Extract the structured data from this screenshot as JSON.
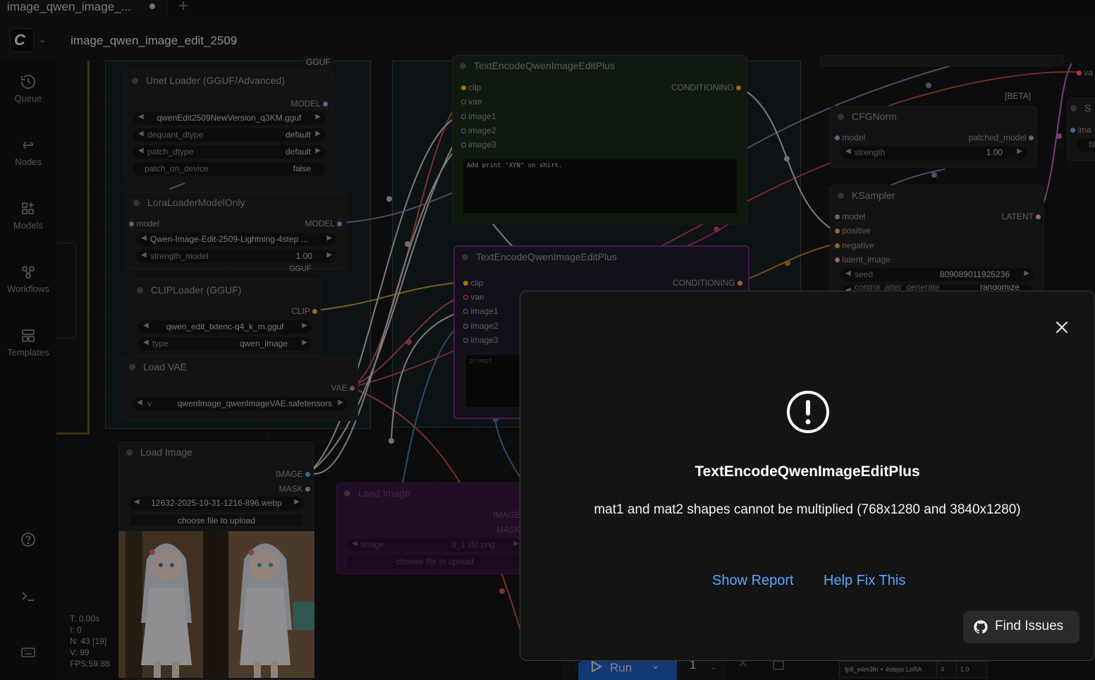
{
  "tab": {
    "title": "image_qwen_image_...",
    "add_label": "+"
  },
  "menubar": {
    "workflow_name": "image_qwen_image_edit_2509",
    "logo_glyph": "C"
  },
  "sidebar": {
    "items": [
      {
        "label": "Queue",
        "icon": "history-icon"
      },
      {
        "label": "Nodes",
        "icon": "nodes-icon"
      },
      {
        "label": "Models",
        "icon": "models-icon"
      },
      {
        "label": "Workflows",
        "icon": "workflows-icon"
      },
      {
        "label": "Templates",
        "icon": "templates-icon"
      }
    ]
  },
  "stats": {
    "t": "T: 0.00s",
    "i": "I: 0",
    "n": "N: 43 [19]",
    "v": "V: 99",
    "fps": "FPS:59.88"
  },
  "nodes": {
    "gguf_tag": "GGUF",
    "gguf_tag2": "GGUF",
    "unet": {
      "title": "Unet Loader (GGUF/Advanced)",
      "out": "MODEL",
      "unet_name": "qwenEdit2509NewVersion_q3KM.gguf",
      "dequant_label": "dequant_dtype",
      "dequant_value": "default",
      "patch_label": "patch_dtype",
      "patch_value": "default",
      "device_label": "patch_on_device",
      "device_value": "false"
    },
    "lora": {
      "title": "LoraLoaderModelOnly",
      "in": "model",
      "out": "MODEL",
      "lora_name": "Qwen-Image-Edit-2509-Lightning-4step ...",
      "strength_label": "strength_model",
      "strength_value": "1.00"
    },
    "clip": {
      "title": "CLIPLoader (GGUF)",
      "out": "CLIP",
      "clip_name": "qwen_edit_txtenc-q4_k_m.gguf",
      "type_label": "type",
      "type_value": "qwen_image"
    },
    "vae": {
      "title": "Load VAE",
      "out": "VAE",
      "vae_prefix": "v",
      "vae_name": "qwenImage_qwenImageVAE.safetensors"
    },
    "load_image": {
      "title": "Load Image",
      "out1": "IMAGE",
      "out2": "MASK",
      "image_name": "12632-2025-10-31-1216-896.webp",
      "upload": "choose file to upload"
    },
    "load_image2": {
      "title": "Load Image",
      "out1": "IMAGE",
      "out2": "MASK",
      "image_prefix": "image",
      "image_name": "0_1 (5).png",
      "upload": "choose file to upload"
    },
    "te1": {
      "title": "TextEncodeQwenImageEditPlus",
      "inputs": [
        "clip",
        "vae",
        "image1",
        "image2",
        "image3"
      ],
      "out": "CONDITIONING",
      "prompt": "Add print \"XYN\" on shirt."
    },
    "te2": {
      "title": "TextEncodeQwenImageEditPlus",
      "inputs": [
        "clip",
        "vae",
        "image1",
        "image2",
        "image3"
      ],
      "out": "CONDITIONING",
      "prompt_placeholder": "prompt"
    },
    "cfg": {
      "beta": "[BETA]",
      "title": "CFGNorm",
      "in": "model",
      "out": "patched_model",
      "strength_label": "strength",
      "strength_value": "1.00"
    },
    "ksampler": {
      "title": "KSampler",
      "inputs": [
        "model",
        "positive",
        "negative",
        "latent_image"
      ],
      "out": "LATENT",
      "seed_label": "seed",
      "seed_value": "809089011925236",
      "control_label": "control_after_generate",
      "control_value": "randomize"
    },
    "edge": {
      "title": "S",
      "in": "ima",
      "widget": "fil",
      "out": "va"
    }
  },
  "dialog": {
    "title": "TextEncodeQwenImageEditPlus",
    "message": "mat1 and mat2 shapes cannot be multiplied (768x1280 and 3840x1280)",
    "show_report": "Show Report",
    "help_fix": "Help Fix This",
    "find_issues": "Find Issues"
  },
  "runbar": {
    "run_label": "Run",
    "queue_count": "1"
  },
  "table_peek": {
    "c1": "fp8_e4m3fn + 4steps LoRA",
    "c2": "4",
    "c3": "1.0"
  },
  "colors": {
    "accent_link": "#5aa8ff",
    "clip": "#f5c518",
    "vae": "#ff6b6b",
    "image": "#64b5f6",
    "model": "#b39ddb",
    "conditioning": "#ffa931",
    "latent": "#ff9cf9"
  }
}
